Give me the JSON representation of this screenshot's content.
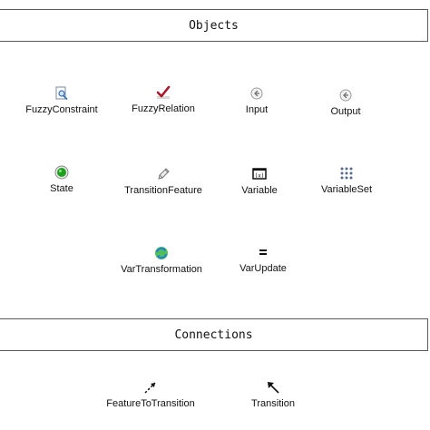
{
  "sections": {
    "objects_title": "Objects",
    "connections_title": "Connections"
  },
  "objects": [
    {
      "label": "FuzzyConstraint",
      "icon": "magnifier-doc-icon"
    },
    {
      "label": "FuzzyRelation",
      "icon": "checkmark-red-icon"
    },
    {
      "label": "Input",
      "icon": "input-arrow-icon"
    },
    {
      "label": "Output",
      "icon": "output-arrow-icon"
    },
    {
      "label": "State",
      "icon": "green-circle-icon"
    },
    {
      "label": "TransitionFeature",
      "icon": "pencil-icon"
    },
    {
      "label": "Variable",
      "icon": "variable-box-icon"
    },
    {
      "label": "VariableSet",
      "icon": "grid-dots-icon"
    },
    {
      "label": "VarTransformation",
      "icon": "refresh-globe-icon"
    },
    {
      "label": "VarUpdate",
      "icon": "equals-icon"
    }
  ],
  "connections": [
    {
      "label": "FeatureToTransition",
      "icon": "dashed-arrow-icon"
    },
    {
      "label": "Transition",
      "icon": "arrow-up-left-icon"
    }
  ],
  "colors": {
    "border": "#5a5a5a",
    "state_green": "#1fa01f",
    "relation_red": "#a8172a",
    "transform_blue": "#2a7fd4"
  }
}
